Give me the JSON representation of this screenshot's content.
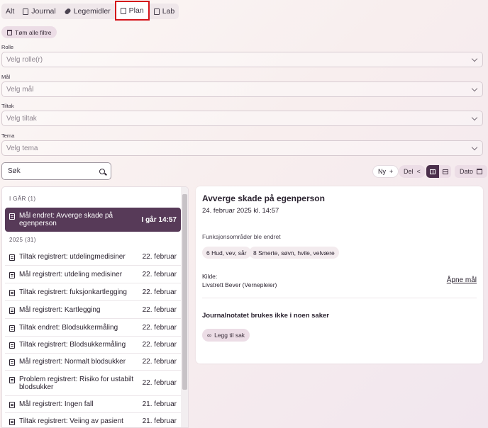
{
  "tabs": [
    {
      "label": "Alt",
      "icon": ""
    },
    {
      "label": "Journal",
      "icon": "document-icon"
    },
    {
      "label": "Legemidler",
      "icon": "pill-icon"
    },
    {
      "label": "Plan",
      "icon": "document-icon"
    },
    {
      "label": "Lab",
      "icon": "flask-icon"
    }
  ],
  "active_tab": "Plan",
  "clear_filters": "Tøm alle filtre",
  "filters": [
    {
      "label": "Rolle",
      "placeholder": "Velg rolle(r)"
    },
    {
      "label": "Mål",
      "placeholder": "Velg mål"
    },
    {
      "label": "Tiltak",
      "placeholder": "Velg tiltak"
    },
    {
      "label": "Tema",
      "placeholder": "Velg tema"
    }
  ],
  "search": {
    "placeholder": "Søk"
  },
  "toolbar": {
    "new": "Ny",
    "new_icon": "+",
    "share": "Del",
    "share_icon": "<",
    "date": "Dato"
  },
  "groups": [
    {
      "heading": "I GÅR (1)"
    },
    {
      "heading": "2025 (31)"
    }
  ],
  "entries": [
    {
      "title": "Mål endret: Avverge skade på egenperson",
      "date": "I går 14:57"
    },
    {
      "title": "Tiltak registrert: utdelingmedisiner",
      "date": "22. februar"
    },
    {
      "title": "Mål registrert: utdeling medisiner",
      "date": "22. februar"
    },
    {
      "title": "Tiltak registrert: fuksjonkartlegging",
      "date": "22. februar"
    },
    {
      "title": "Mål registrert: Kartlegging",
      "date": "22. februar"
    },
    {
      "title": "Tiltak endret: Blodsukkermåling",
      "date": "22. februar"
    },
    {
      "title": "Tiltak registrert: Blodsukkermåling",
      "date": "22. februar"
    },
    {
      "title": "Mål registrert: Normalt blodsukker",
      "date": "22. februar"
    },
    {
      "title": "Problem registrert: Risiko for ustabilt blodsukker",
      "date": "22. februar"
    },
    {
      "title": "Mål registrert: Ingen fall",
      "date": "21. februar"
    },
    {
      "title": "Tiltak registrert: Veiing av pasient",
      "date": "21. februar"
    }
  ],
  "detail": {
    "title": "Avverge skade på egenperson",
    "timestamp": "24. februar 2025 kl. 14:57",
    "changed_label": "Funksjonsområder ble endret",
    "tags": [
      "6 Hud, vev, sår",
      "8 Smerte, søvn, hvile, velvære"
    ],
    "source_label": "Kilde:",
    "source_value": "Livstrett Bever (Vernepleier)",
    "open_link": "Åpne mål",
    "note": "Journalnotatet brukes ikke i noen saker",
    "add_button": "Legg til sak"
  }
}
